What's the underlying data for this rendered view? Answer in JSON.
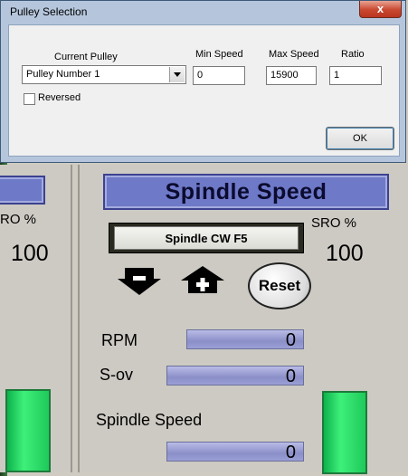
{
  "dialog": {
    "title": "Pulley Selection",
    "close_glyph": "x",
    "current_pulley_label": "Current Pulley",
    "current_pulley_value": "Pulley Number 1",
    "min_speed_label": "Min Speed",
    "min_speed_value": "0",
    "max_speed_label": "Max Speed",
    "max_speed_value": "15900",
    "ratio_label": "Ratio",
    "ratio_value": "1",
    "reversed_label": "Reversed",
    "reversed_checked": false,
    "ok_label": "OK"
  },
  "left_panel": {
    "sro_label": "RO %",
    "sro_value": "100"
  },
  "spindle_panel": {
    "title": "Spindle Speed",
    "spindle_button_label": "Spindle CW F5",
    "sro_label": "SRO %",
    "sro_value": "100",
    "decrease_icon": "arrow-down-minus",
    "increase_icon": "arrow-up-plus",
    "reset_label": "Reset",
    "rpm_label": "RPM",
    "rpm_value": "0",
    "sov_label": "S-ov",
    "sov_value": "0",
    "spindle_speed_label": "Spindle Speed",
    "spindle_speed_value": "0"
  },
  "colors": {
    "banner_blue": "#6e79c8",
    "dro_blue": "#9b9fd6",
    "indicator_green": "#3ef07a",
    "close_red": "#c9472f"
  }
}
